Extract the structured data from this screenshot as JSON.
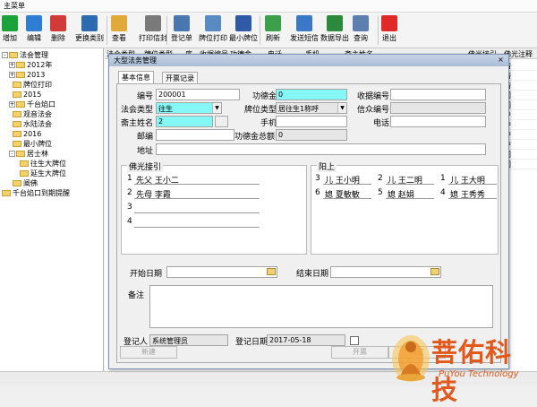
{
  "window": {
    "title": "主菜单"
  },
  "toolbar": [
    {
      "label": "增加",
      "icon": "add-icon",
      "color": "#1aa33a"
    },
    {
      "label": "编辑",
      "icon": "edit-icon",
      "color": "#2e7ed6"
    },
    {
      "label": "删除",
      "icon": "delete-icon",
      "color": "#d23a3a"
    },
    {
      "label": "更换类别",
      "icon": "switch-category-icon",
      "color": "#2c6bb0"
    },
    {
      "label": "查看",
      "icon": "view-icon",
      "color": "#e0a93a"
    },
    {
      "label": "打印信封",
      "icon": "print-envelope-icon",
      "color": "#7a7a7a"
    },
    {
      "label": "登记单",
      "icon": "register-form-icon",
      "color": "#4a77b0"
    },
    {
      "label": "牌位打印",
      "icon": "tablet-print-icon",
      "color": "#5a8ac4"
    },
    {
      "label": "最小牌位",
      "icon": "small-tablet-icon",
      "color": "#2f5aa8"
    },
    {
      "label": "刷新",
      "icon": "refresh-icon",
      "color": "#3aa14a"
    },
    {
      "label": "发送短信",
      "icon": "sms-icon",
      "color": "#3c78c8"
    },
    {
      "label": "数据导出",
      "icon": "export-icon",
      "color": "#2c8a3c"
    },
    {
      "label": "查询",
      "icon": "query-icon",
      "color": "#5c7fb0"
    },
    {
      "label": "退出",
      "icon": "exit-icon",
      "color": "#e02828"
    }
  ],
  "tree": [
    {
      "label": "法会管理",
      "pm": "-"
    },
    {
      "label": "2012年",
      "pm": "+"
    },
    {
      "label": "2013",
      "pm": "+"
    },
    {
      "label": "牌位打印",
      "pm": ""
    },
    {
      "label": "2015",
      "pm": ""
    },
    {
      "label": "千台焰口",
      "pm": "+"
    },
    {
      "label": "观音法会",
      "pm": ""
    },
    {
      "label": "水陆法会",
      "pm": ""
    },
    {
      "label": "2016",
      "pm": ""
    },
    {
      "label": "最小牌位",
      "pm": ""
    },
    {
      "label": "居士林",
      "pm": "-"
    },
    {
      "label": "往生大牌位",
      "pm": ""
    },
    {
      "label": "延生大牌位",
      "pm": ""
    },
    {
      "label": "阐佛",
      "pm": ""
    },
    {
      "label": "千台焰口到期提醒",
      "pm": ""
    }
  ],
  "background_grid": {
    "columns": [
      "法会类型",
      "牌位类型",
      "序",
      "收据编号",
      "功德金",
      "电话",
      "手机",
      "斋主姓名",
      "佛光接引",
      "佛光注释"
    ],
    "last_column_cells": [
      "斋",
      "斋",
      "斋",
      "门",
      "门",
      "沪",
      "沪",
      "沪",
      "沪",
      "门",
      "门"
    ]
  },
  "dialog": {
    "title": "大型法务管理",
    "close": "×",
    "tabs": [
      "基本信息",
      "开票记录"
    ],
    "fields": {
      "biaohao": {
        "label": "编号",
        "value": "200001"
      },
      "gongdejin": {
        "label": "功德金",
        "value": "0"
      },
      "shouju": {
        "label": "收据编号",
        "value": ""
      },
      "fahui_type": {
        "label": "法会类型",
        "value": "往生"
      },
      "paiwei_type": {
        "label": "牌位类型",
        "value": "居往生1称呼"
      },
      "xinqi": {
        "label": "信众编号",
        "value": ""
      },
      "zhaizhu": {
        "label": "斋主姓名",
        "value": "2"
      },
      "shouji": {
        "label": "手机",
        "value": ""
      },
      "dianhua": {
        "label": "电话",
        "value": ""
      },
      "youbian": {
        "label": "邮编",
        "value": ""
      },
      "gongdejin_total": {
        "label": "功德金总额",
        "value": "0"
      },
      "dizhi": {
        "label": "地址",
        "value": ""
      }
    },
    "foguang": {
      "title": "佛光接引",
      "rows": [
        {
          "num": "1",
          "text": "先父 王小二"
        },
        {
          "num": "2",
          "text": "先母 李霞"
        },
        {
          "num": "3",
          "text": ""
        },
        {
          "num": "4",
          "text": ""
        }
      ]
    },
    "yangshang": {
      "title": "阳上",
      "rows": [
        {
          "num": "3",
          "text": "儿 王小明"
        },
        {
          "num": "2",
          "text": "儿 王二明"
        },
        {
          "num": "1",
          "text": "儿 王大明"
        },
        {
          "num": "6",
          "text": "媳 夏敏敏"
        },
        {
          "num": "5",
          "text": "媳 赵娟"
        },
        {
          "num": "4",
          "text": "媳 王秀秀"
        }
      ]
    },
    "start_date": {
      "label": "开始日期",
      "value": ""
    },
    "end_date": {
      "label": "结束日期",
      "value": ""
    },
    "remark": {
      "label": "备注",
      "value": ""
    },
    "registrar": {
      "label": "登记人",
      "value": "系统管理员"
    },
    "reg_date": {
      "label": "登记日期",
      "value": "2017-05-18"
    },
    "buttons": {
      "new": "新建",
      "invoice": "开票",
      "ok": "确定"
    }
  },
  "logo": {
    "text": "菩佑科技",
    "subtitle": "PuYou Technology",
    "color": "#e2591c"
  }
}
